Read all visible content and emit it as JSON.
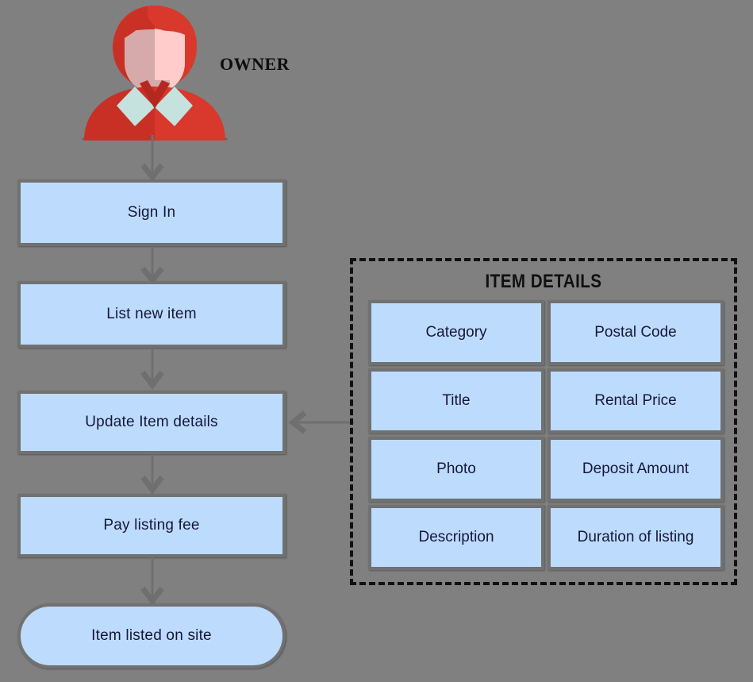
{
  "diagram": {
    "background_color": "#808080",
    "node_fill": "#bddcfd",
    "node_border": "#717171",
    "panel_border": "#111111",
    "actor": {
      "label": "OWNER",
      "icon": "person-avatar-icon",
      "colors": {
        "hair": "#d9382c",
        "hair_shadow": "#b3291f",
        "face_light": "#ffcccb",
        "face_shadow": "#d6aaab",
        "collar": "#c5e2de",
        "shirt": "#d9382c",
        "shirt_shadow": "#b3291f"
      }
    },
    "flow": {
      "nodes": [
        {
          "id": "sign-in",
          "label": "Sign In",
          "shape": "rect"
        },
        {
          "id": "list-new-item",
          "label": "List new item",
          "shape": "rect"
        },
        {
          "id": "update-item-details",
          "label": "Update Item details",
          "shape": "rect"
        },
        {
          "id": "pay-listing-fee",
          "label": "Pay listing fee",
          "shape": "rect"
        },
        {
          "id": "item-listed-on-site",
          "label": "Item listed on site",
          "shape": "terminal"
        }
      ],
      "edges": [
        {
          "from": "owner",
          "to": "sign-in",
          "direction": "down"
        },
        {
          "from": "sign-in",
          "to": "list-new-item",
          "direction": "down"
        },
        {
          "from": "list-new-item",
          "to": "update-item-details",
          "direction": "down"
        },
        {
          "from": "update-item-details",
          "to": "pay-listing-fee",
          "direction": "down"
        },
        {
          "from": "pay-listing-fee",
          "to": "item-listed-on-site",
          "direction": "down"
        },
        {
          "from": "item-details-panel",
          "to": "update-item-details",
          "direction": "left"
        }
      ]
    },
    "panel": {
      "title": "ITEM DETAILS",
      "cells": [
        {
          "label": "Category"
        },
        {
          "label": "Postal Code"
        },
        {
          "label": "Title"
        },
        {
          "label": "Rental Price"
        },
        {
          "label": "Photo"
        },
        {
          "label": "Deposit Amount"
        },
        {
          "label": "Description"
        },
        {
          "label": "Duration of listing"
        }
      ]
    }
  }
}
